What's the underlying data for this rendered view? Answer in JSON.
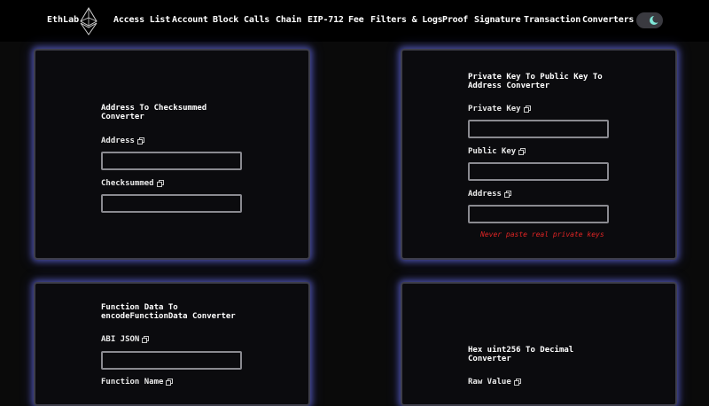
{
  "app": {
    "brand": "EthLab"
  },
  "nav": {
    "items": [
      {
        "label": "Access List"
      },
      {
        "label": "Account"
      },
      {
        "label": "Block"
      },
      {
        "label": "Calls"
      },
      {
        "label": "Chain"
      },
      {
        "label": "EIP-712"
      },
      {
        "label": "Fee"
      },
      {
        "label": "Filters & Logs"
      },
      {
        "label": "Proof"
      },
      {
        "label": "Signature"
      },
      {
        "label": "Transaction"
      },
      {
        "label": "Converters"
      }
    ]
  },
  "theme": {
    "mode_icon": "moon-icon",
    "accent_glow": "#6f78ff",
    "warning_color": "#e02424"
  },
  "cards": {
    "address_checksum": {
      "title": "Address To Checksummed Converter",
      "fields": [
        {
          "label": "Address",
          "value": ""
        },
        {
          "label": "Checksummed",
          "value": ""
        }
      ]
    },
    "private_key": {
      "title": "Private Key To Public Key To Address Converter",
      "fields": [
        {
          "label": "Private Key",
          "value": ""
        },
        {
          "label": "Public Key",
          "value": ""
        },
        {
          "label": "Address",
          "value": ""
        }
      ],
      "warning": "Never paste real private keys"
    },
    "function_data": {
      "title": "Function Data To encodeFunctionData Converter",
      "fields": [
        {
          "label": "ABI JSON",
          "value": ""
        },
        {
          "label": "Function Name",
          "value": ""
        }
      ]
    },
    "hex_uint256": {
      "title": "Hex uint256 To Decimal Converter",
      "fields": [
        {
          "label": "Raw Value",
          "value": ""
        }
      ]
    }
  }
}
